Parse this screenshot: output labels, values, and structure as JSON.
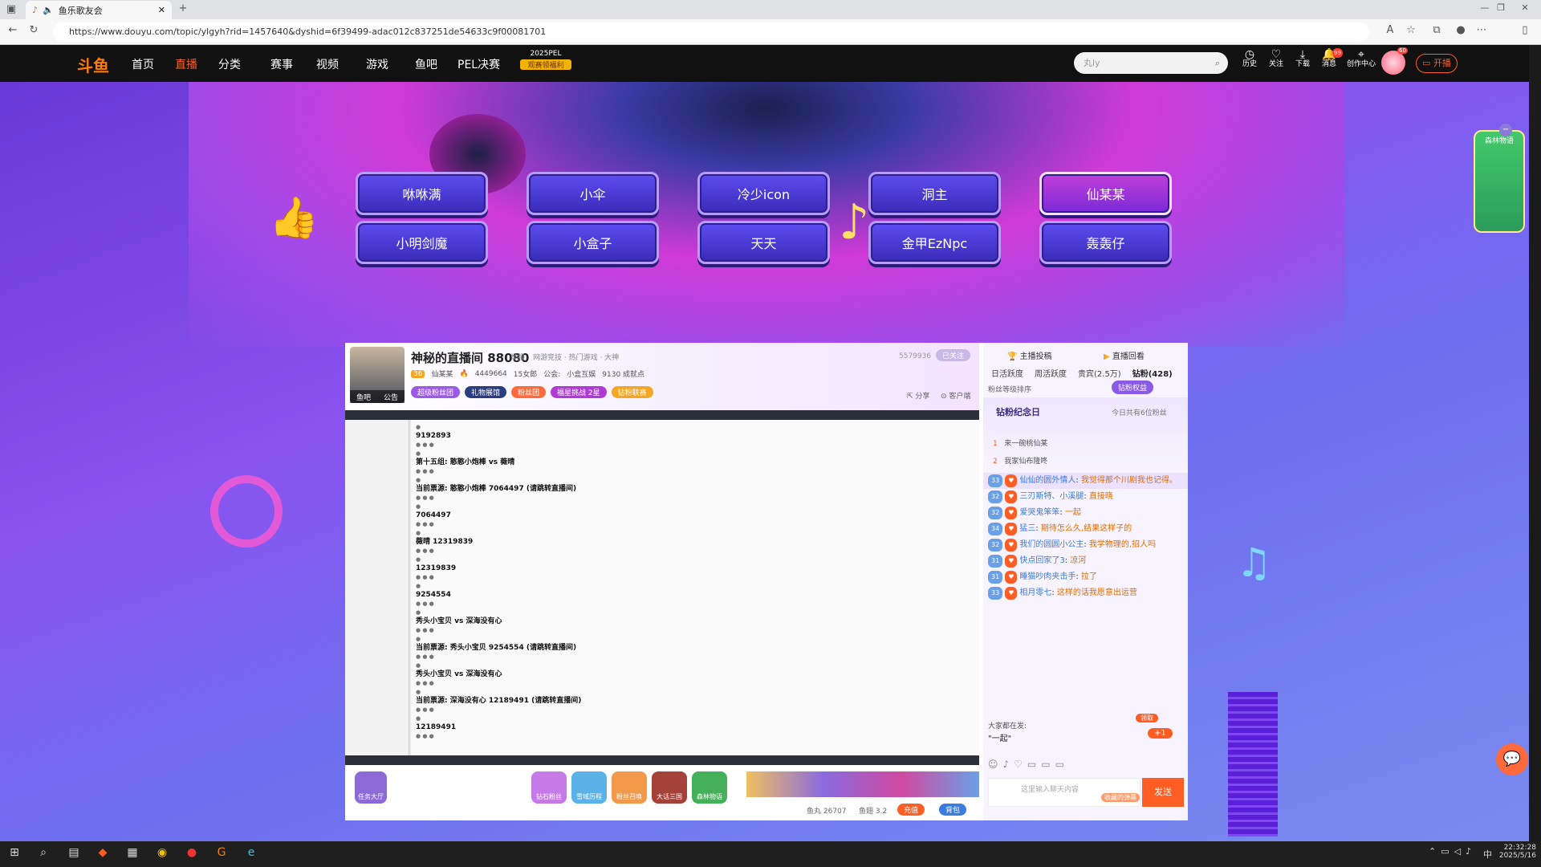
{
  "browser": {
    "tab_title": "鱼乐歌友会",
    "url": "https://www.douyu.com/topic/ylgyh?rid=1457640&dyshid=6f39499-adac012c837251de54633c9f00081701"
  },
  "nav": {
    "logo": "斗鱼",
    "items": [
      "首页",
      "直播",
      "分类",
      "赛事",
      "视频",
      "游戏",
      "鱼吧",
      "PEL决赛"
    ],
    "active": "直播",
    "promo_top": "2025PEL",
    "promo_bottom": "观赛领福利",
    "search_placeholder": "丸ly",
    "icons": [
      "历史",
      "关注",
      "下载",
      "消息",
      "创作中心"
    ],
    "kaibo": "开播",
    "badge_msg": "99",
    "badge_avatar": "60"
  },
  "singers": {
    "row1": [
      "咻咻满",
      "小伞",
      "冷少icon",
      "洞主",
      "仙某某"
    ],
    "row2": [
      "小明剑魔",
      "小盒子",
      "天天",
      "金甲EzNpc",
      "轰轰仔"
    ],
    "active": "仙某某"
  },
  "room": {
    "title": "神秘的直播间 88080",
    "report": "举报",
    "category": "网游竞技 · 热门游戏 · 大神",
    "lvl": "36",
    "anchor": "仙某某",
    "hot": "4449664",
    "fans": "15女郎",
    "guild_label": "公会:",
    "guild": "小盒互娱",
    "achievement": "9130 成就点",
    "tags": [
      "超级粉丝团",
      "礼物展馆",
      "粉丝团",
      "福星挑战 2星",
      "钻粉联赛"
    ],
    "follow_count": "5579936",
    "followed": "已关注",
    "share": "分享",
    "client": "客户端",
    "avatar_label": "鱼吧",
    "notice_label": "公告"
  },
  "video": {
    "lines": [
      {
        "t": "9192893",
        "k": "b"
      },
      {
        "t": "第十五组: 憨憨小炮棒 vs 薇晴",
        "k": "b"
      },
      {
        "t": "当前票源: 憨憨小炮棒 7064497 (请跳转直播间)",
        "k": "b"
      },
      {
        "t": "7064497",
        "k": "b"
      },
      {
        "t": "薇晴 12319839",
        "k": "b"
      },
      {
        "t": "12319839",
        "k": "b"
      },
      {
        "t": "9254554",
        "k": "b"
      },
      {
        "t": "秀头小宝贝 vs 深海没有心",
        "k": "b"
      },
      {
        "t": "当前票源: 秀头小宝贝 9254554 (请跳转直播间)",
        "k": "b"
      },
      {
        "t": "秀头小宝贝 vs 深海没有心",
        "k": "b"
      },
      {
        "t": "当前票源: 深海没有心 12189491 (请跳转直播间)",
        "k": "b"
      },
      {
        "t": "12189491",
        "k": "b"
      }
    ]
  },
  "bottom_icons": [
    "任务大厅",
    "钻石粉丝",
    "雪域历程",
    "粉丝召唤",
    "大话三国",
    "森林物语"
  ],
  "bottom_bar": {
    "yuwan": "鱼丸 26707",
    "yuchi": "鱼翅 3.2",
    "recharge": "充值",
    "bag": "背包"
  },
  "chat": {
    "top_left": "主播投稿",
    "top_right": "直播回看",
    "tabs": [
      "日活跃度",
      "周活跃度",
      "贵宾(2.5万)",
      "钻粉(428)"
    ],
    "rank_label": "粉丝等级排序",
    "rank_btn": "钻粉权益",
    "day_title": "钻粉纪念日",
    "day_count": "今日共有6位粉丝",
    "ranks": [
      {
        "n": "1",
        "name": "来一碗桃仙某"
      },
      {
        "n": "2",
        "name": "我家仙布隆咚"
      }
    ],
    "messages": [
      {
        "lvl": "33",
        "name": "仙仙的圆外情人",
        "text": "我觉得那个川剧我也记得。"
      },
      {
        "lvl": "32",
        "name": "三刃斯特、小溪腿",
        "text": "直接晓"
      },
      {
        "lvl": "32",
        "name": "爱哭鬼笨笨",
        "text": "一起"
      },
      {
        "lvl": "34",
        "name": "猛三",
        "text": "期待怎么久,结果这样子的"
      },
      {
        "lvl": "32",
        "name": "我们的圆圆小公主",
        "text": "我学物理的,招人吗"
      },
      {
        "lvl": "31",
        "name": "快点回家了3",
        "text": "凉河"
      },
      {
        "lvl": "31",
        "name": "睡猫吵肉夹击手",
        "text": "拉了"
      },
      {
        "lvl": "33",
        "name": "相月零七",
        "text": "这样的话我愿意出运营"
      }
    ],
    "everyone_label": "大家都在发:",
    "everyone_text": "\"一起\"",
    "plus1": "+1",
    "input_placeholder": "这里输入聊天内容",
    "send": "发送",
    "barrage": "收藏的弹幕",
    "claim": "领取"
  },
  "taskbar": {
    "time": "22:32:28",
    "date": "2025/5/16",
    "lang": "中"
  }
}
